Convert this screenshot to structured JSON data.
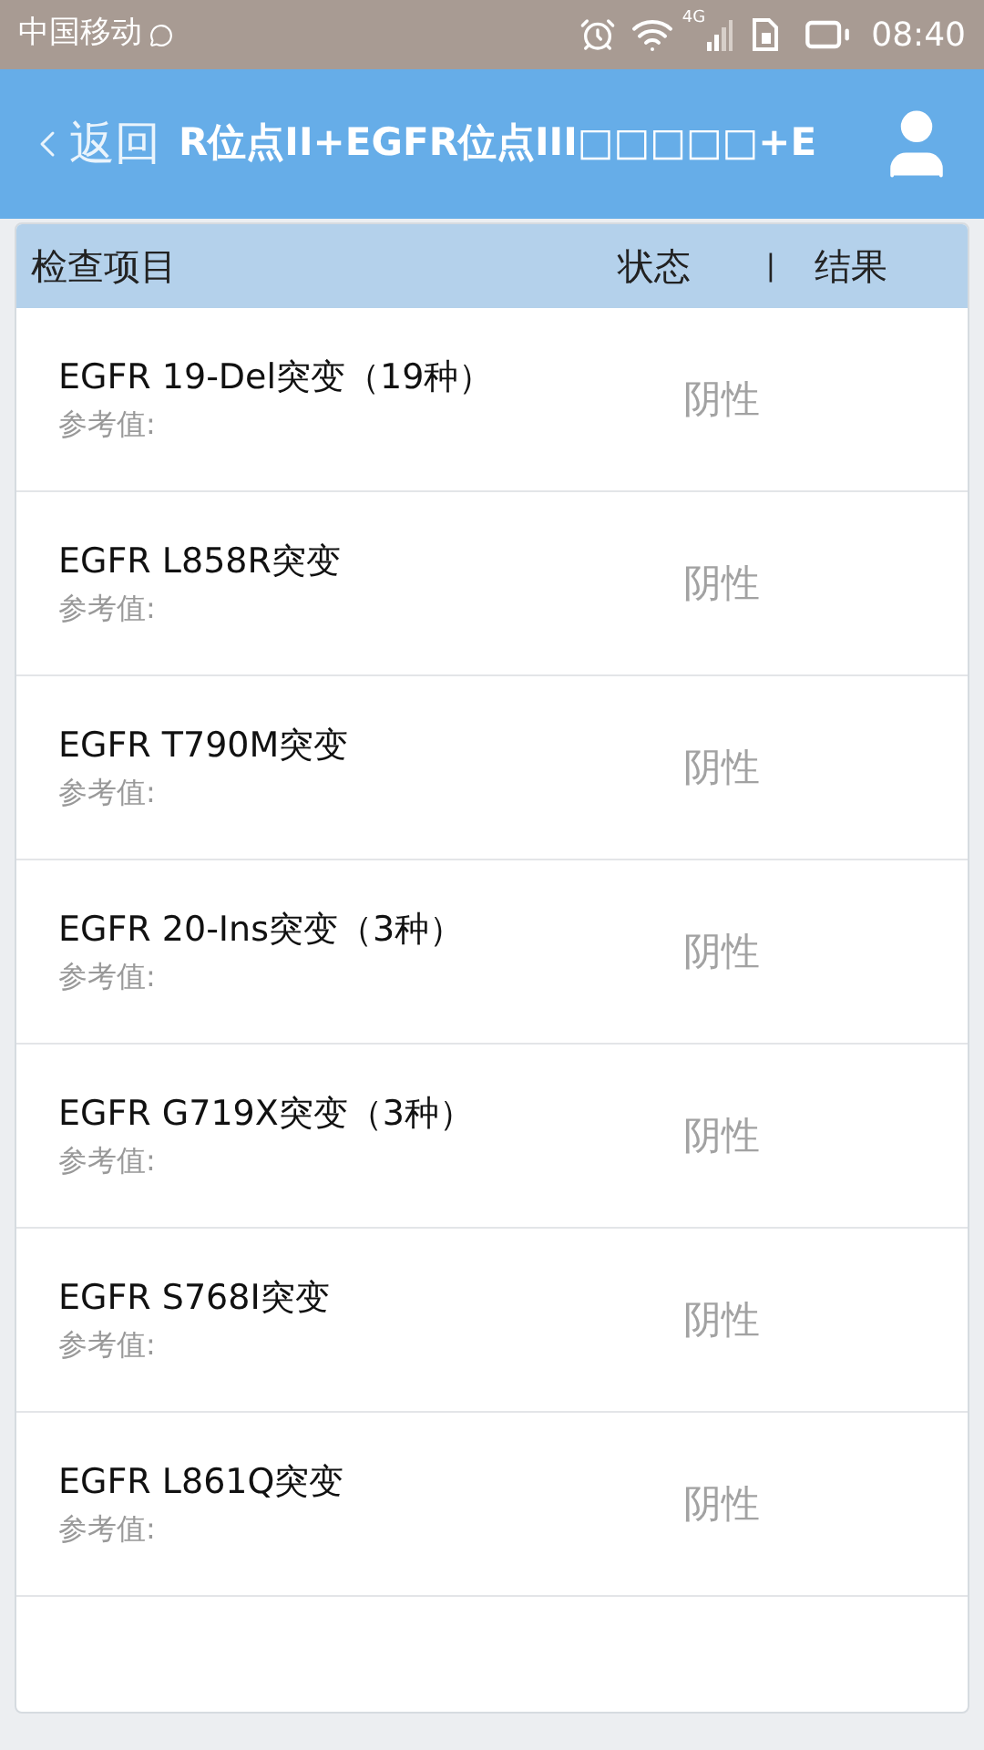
{
  "status_bar": {
    "carrier": "中国移动",
    "network_type": "4G",
    "time": "08:40"
  },
  "header": {
    "back_label": "返回",
    "title": "R位点II+EGFR位点III□□□□□+E"
  },
  "table": {
    "columns": [
      "检查项目",
      "状态",
      "|",
      "结果"
    ],
    "rows": [
      {
        "name": "EGFR 19-Del突变（19种）",
        "reference": "参考值:",
        "status": "阴性"
      },
      {
        "name": "EGFR L858R突变",
        "reference": "参考值:",
        "status": "阴性"
      },
      {
        "name": "EGFR T790M突变",
        "reference": "参考值:",
        "status": "阴性"
      },
      {
        "name": "EGFR 20-Ins突变（3种）",
        "reference": "参考值:",
        "status": "阴性"
      },
      {
        "name": "EGFR G719X突变（3种）",
        "reference": "参考值:",
        "status": "阴性"
      },
      {
        "name": "EGFR S768I突变",
        "reference": "参考值:",
        "status": "阴性"
      },
      {
        "name": "EGFR L861Q突变",
        "reference": "参考值:",
        "status": "阴性"
      }
    ]
  }
}
